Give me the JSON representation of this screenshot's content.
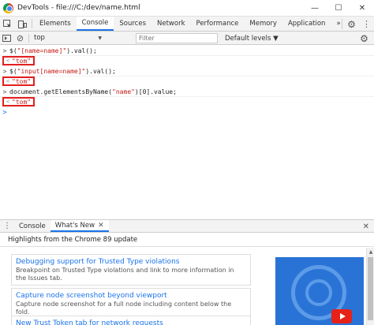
{
  "window": {
    "title": "DevTools - file:///C:/dev/name.html",
    "minimize": "—",
    "maximize": "☐",
    "close": "✕"
  },
  "toolbar": {
    "inspect_icon": "inspect-icon",
    "device_icon": "device-toolbar-icon",
    "tabs": [
      "Elements",
      "Console",
      "Sources",
      "Network",
      "Performance",
      "Memory",
      "Application"
    ],
    "active_tab": "Console",
    "more_tabs": "»",
    "settings_icon": "⚙",
    "menu_icon": "⋮"
  },
  "consolebar": {
    "context": "top",
    "context_arrow": "▼",
    "filter_placeholder": "Filter",
    "levels": "Default levels ▼",
    "sidebar_icon": "▸",
    "clear_icon": "⊘",
    "eye_icon": "👁",
    "settings_icon": "⚙"
  },
  "console": {
    "entries": [
      {
        "prompt": ">",
        "cmd_pre": "$(",
        "cmd_str": "\"[name=name]\"",
        "cmd_post": ").val();",
        "result_arrow": "<",
        "result": "\"tom\""
      },
      {
        "prompt": ">",
        "cmd_pre": "$(",
        "cmd_str": "\"input[name=name]\"",
        "cmd_post": ").val();",
        "result_arrow": "<",
        "result": "\"tom\""
      },
      {
        "prompt": ">",
        "cmd_pre": "document.getElementsByName(",
        "cmd_str": "\"name\"",
        "cmd_post": ")[0].value;",
        "result_arrow": "<",
        "result": "\"tom\""
      }
    ],
    "cursor_prompt": ">"
  },
  "drawer": {
    "menu_icon": "⋮",
    "tabs": [
      "Console",
      "What's New"
    ],
    "close_tab": "✕",
    "close_drawer": "✕",
    "header": "Highlights from the Chrome 89 update",
    "cards": [
      {
        "title": "Debugging support for Trusted Type violations",
        "desc": "Breakpoint on Trusted Type violations and link to more information in the Issues tab."
      },
      {
        "title": "Capture node screenshot beyond viewport",
        "desc": "Capture node screenshot for a full node including content below the fold."
      },
      {
        "title": "New Trust Token tab for network requests",
        "desc": ""
      }
    ]
  },
  "colors": {
    "accent": "#1a73e8",
    "highlight_box": "#e41e1e",
    "string": "#c41a16"
  }
}
